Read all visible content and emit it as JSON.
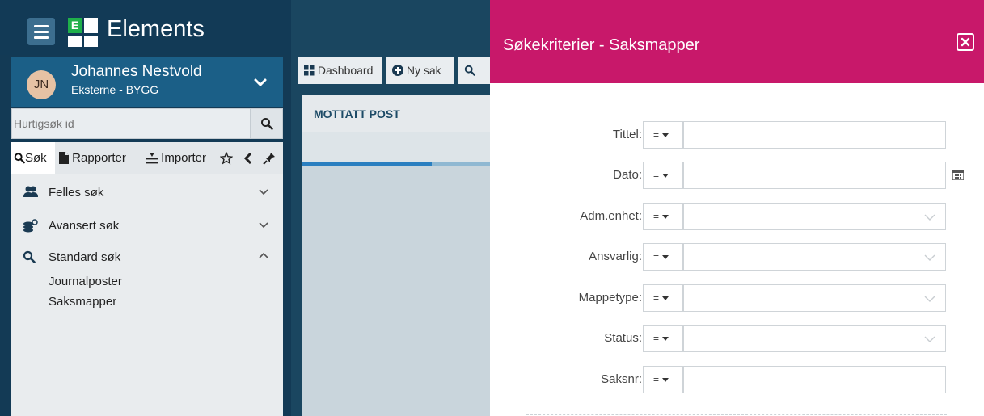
{
  "app": {
    "title": "Elements",
    "logo_letter": "E"
  },
  "user": {
    "initials": "JN",
    "name": "Johannes Nestvold",
    "department": "Eksterne - BYGG"
  },
  "quick_search": {
    "placeholder": "Hurtigsøk id"
  },
  "sidebar_tabs": [
    {
      "label": "Søk",
      "icon": "search-icon"
    },
    {
      "label": "Rapporter",
      "icon": "document-icon"
    },
    {
      "label": "Importer",
      "icon": "import-icon"
    }
  ],
  "sidebar_menu": [
    {
      "label": "Felles søk",
      "icon": "users-icon",
      "expanded": false
    },
    {
      "label": "Avansert søk",
      "icon": "coins-search-icon",
      "expanded": false
    },
    {
      "label": "Standard søk",
      "icon": "search-icon",
      "expanded": true,
      "children": [
        "Journalposter",
        "Saksmapper"
      ]
    }
  ],
  "main_tabs": [
    {
      "label": "Dashboard",
      "icon": "dashboard-icon"
    },
    {
      "label": "Ny sak",
      "icon": "plus-circle-icon"
    },
    {
      "label": "",
      "icon": "search-icon"
    }
  ],
  "panel": {
    "header": "MOTTATT POST"
  },
  "modal": {
    "title": "Søkekriterier - Saksmapper",
    "operator_label": "=",
    "fields": [
      {
        "label": "Tittel:",
        "type": "text",
        "value": ""
      },
      {
        "label": "Dato:",
        "type": "date",
        "value": ""
      },
      {
        "label": "Adm.enhet:",
        "type": "select",
        "value": ""
      },
      {
        "label": "Ansvarlig:",
        "type": "select",
        "value": ""
      },
      {
        "label": "Mappetype:",
        "type": "select",
        "value": ""
      },
      {
        "label": "Status:",
        "type": "select",
        "value": ""
      },
      {
        "label": "Saksnr:",
        "type": "text",
        "value": ""
      }
    ]
  },
  "colors": {
    "sidebar_bg": "#133a55",
    "user_bar": "#1b5f87",
    "modal_header": "#c8186a",
    "logo_green": "#1fb04a"
  }
}
